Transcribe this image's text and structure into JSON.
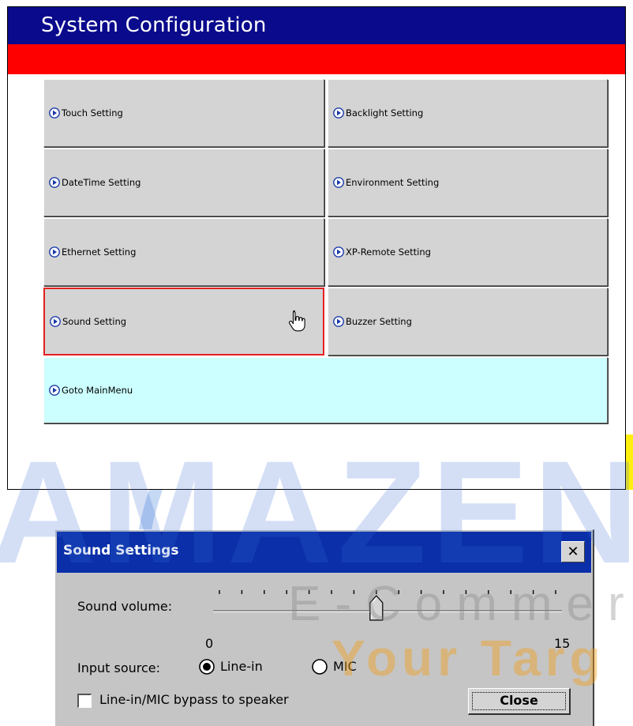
{
  "window": {
    "title": "System Configuration"
  },
  "menu": {
    "items": [
      {
        "label": "Touch Setting"
      },
      {
        "label": "Backlight Setting"
      },
      {
        "label": "DateTime Setting"
      },
      {
        "label": "Environment Setting"
      },
      {
        "label": "Ethernet Setting"
      },
      {
        "label": "XP-Remote Setting"
      },
      {
        "label": "Sound Setting"
      },
      {
        "label": "Buzzer Setting"
      },
      {
        "label": "Goto MainMenu"
      }
    ],
    "selected": "Sound Setting"
  },
  "watermark": {
    "brand": "AMAZEN",
    "line2": "E-Commerc",
    "line3": "Your Targ"
  },
  "dialog": {
    "title": "Sound Settings",
    "close_glyph": "✕",
    "volume_label": "Sound volume:",
    "volume_min": "0",
    "volume_max": "15",
    "volume_value": 7,
    "input_source_label": "Input source:",
    "input_options": [
      "Line-in",
      "MIC"
    ],
    "input_selected": "Line-in",
    "bypass_label": "Line-in/MIC bypass to speaker",
    "bypass_checked": false,
    "close_label": "Close"
  },
  "colors": {
    "title_bar": "#0a0a8c",
    "accent_bar": "#ff0000",
    "button_face": "#d4d4d4",
    "goto_button": "#ccffff",
    "selected_border": "#e32020",
    "dialog_title_bar": "#0a2fa8"
  },
  "icons": {
    "menu_item": "circle-arrow-right-icon",
    "cursor": "hand-pointer-icon"
  }
}
